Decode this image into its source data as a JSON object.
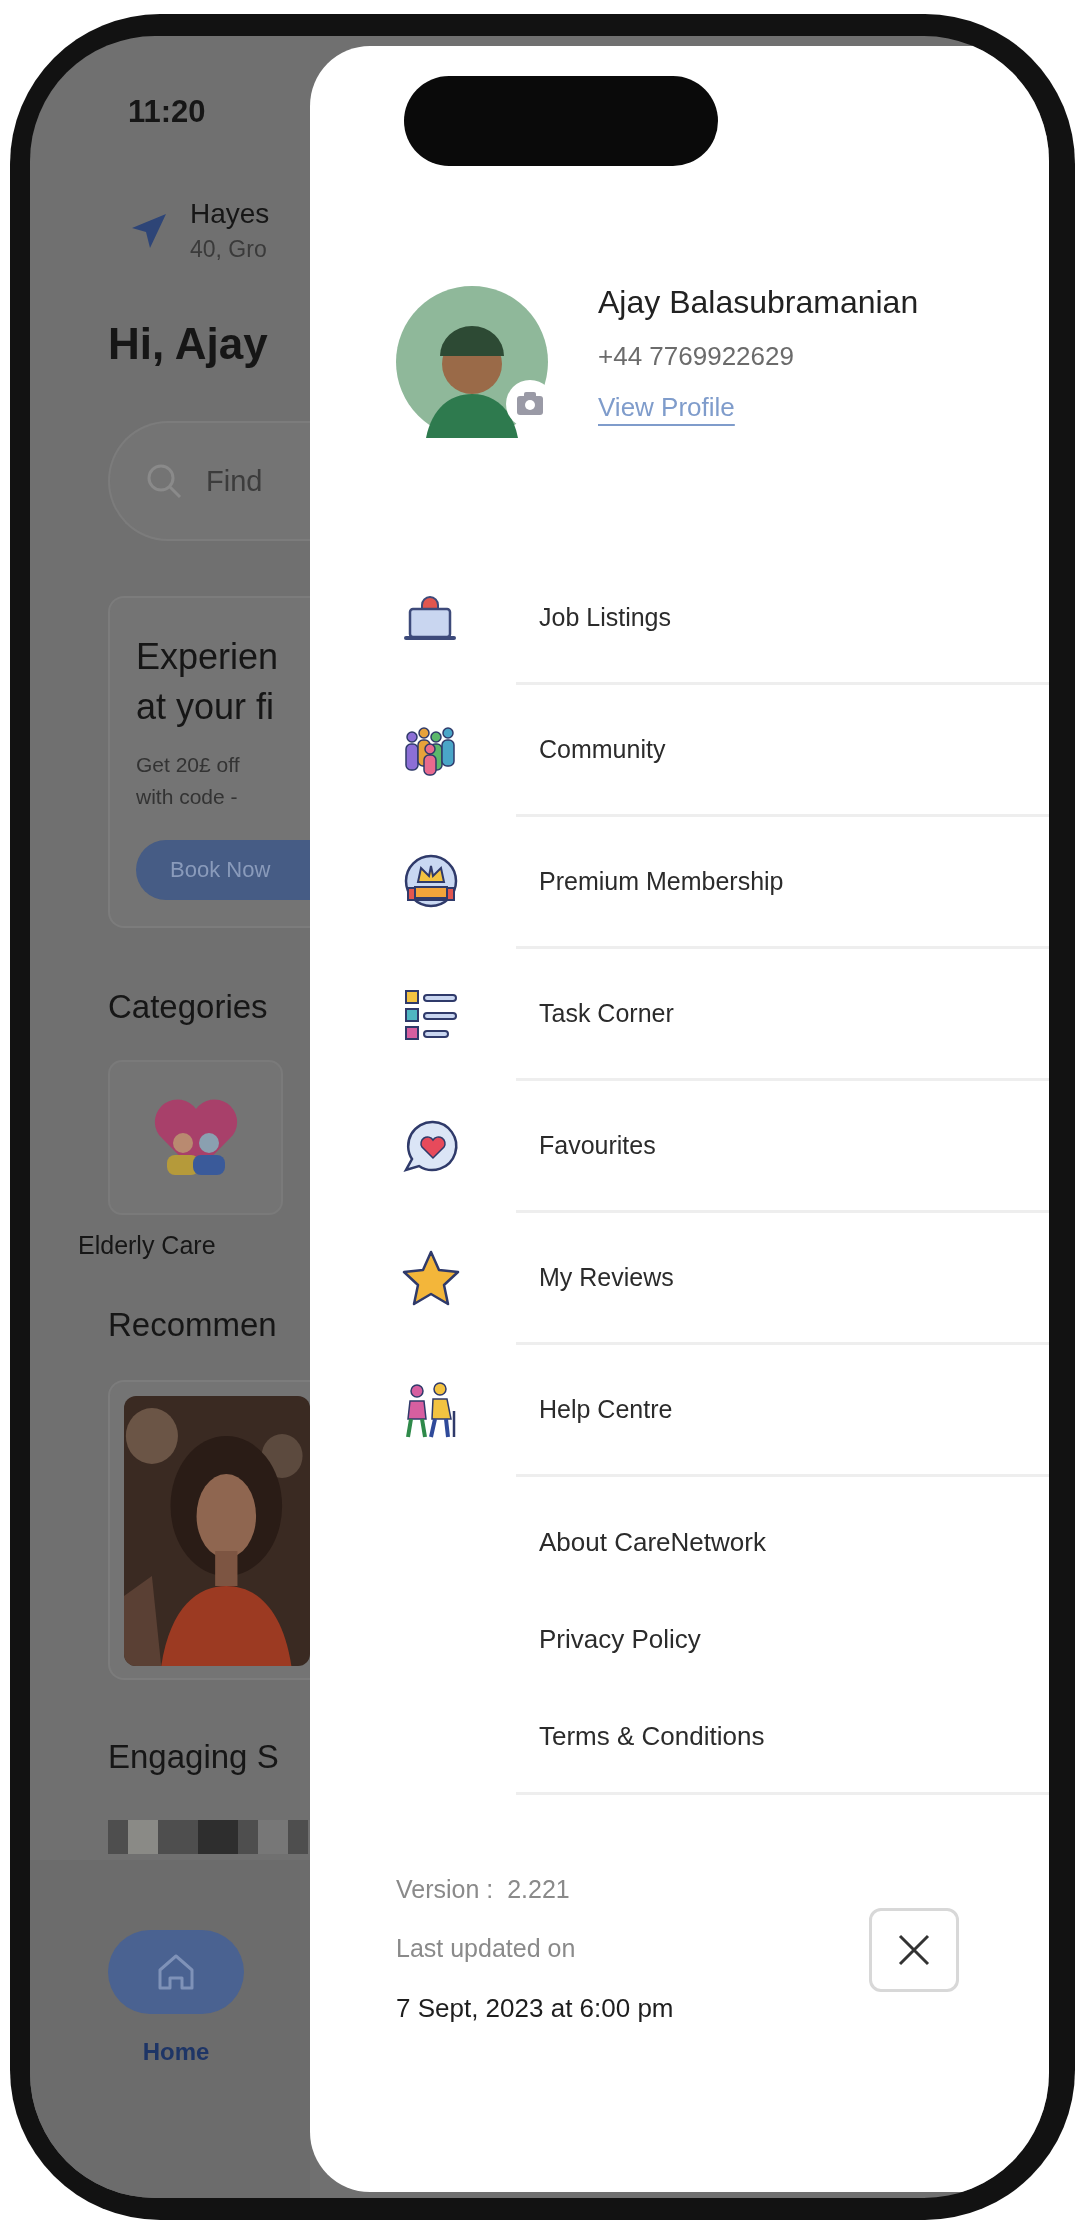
{
  "background_screen": {
    "status_time": "11:20",
    "location": {
      "title": "Hayes",
      "address": "40, Gro"
    },
    "greeting": "Hi, Ajay",
    "search": {
      "placeholder": "Find"
    },
    "promo": {
      "title_lines": [
        "Experien",
        "at your fi"
      ],
      "body_lines": [
        "Get 20£ off",
        "with code -"
      ],
      "button": "Book Now"
    },
    "categories": {
      "title": "Categories",
      "items": [
        {
          "label": "Elderly Care"
        }
      ]
    },
    "recommended": {
      "title": "Recommen"
    },
    "engaging": {
      "title": "Engaging S"
    },
    "bottom_nav": [
      {
        "label": "Home",
        "selected": true
      }
    ]
  },
  "drawer": {
    "profile": {
      "name": "Ajay Balasubramanian",
      "phone": "+44 7769922629",
      "link": "View Profile"
    },
    "menu": [
      {
        "label": "Job Listings"
      },
      {
        "label": "Community"
      },
      {
        "label": "Premium Membership"
      },
      {
        "label": "Task Corner"
      },
      {
        "label": "Favourites"
      },
      {
        "label": "My Reviews"
      },
      {
        "label": "Help Centre"
      }
    ],
    "links": [
      "About CareNetwork",
      "Privacy Policy",
      "Terms & Conditions"
    ],
    "footer": {
      "version": "Version :  2.221",
      "updated_label": "Last updated on",
      "updated_at": "7 Sept, 2023 at 6:00 pm"
    }
  }
}
